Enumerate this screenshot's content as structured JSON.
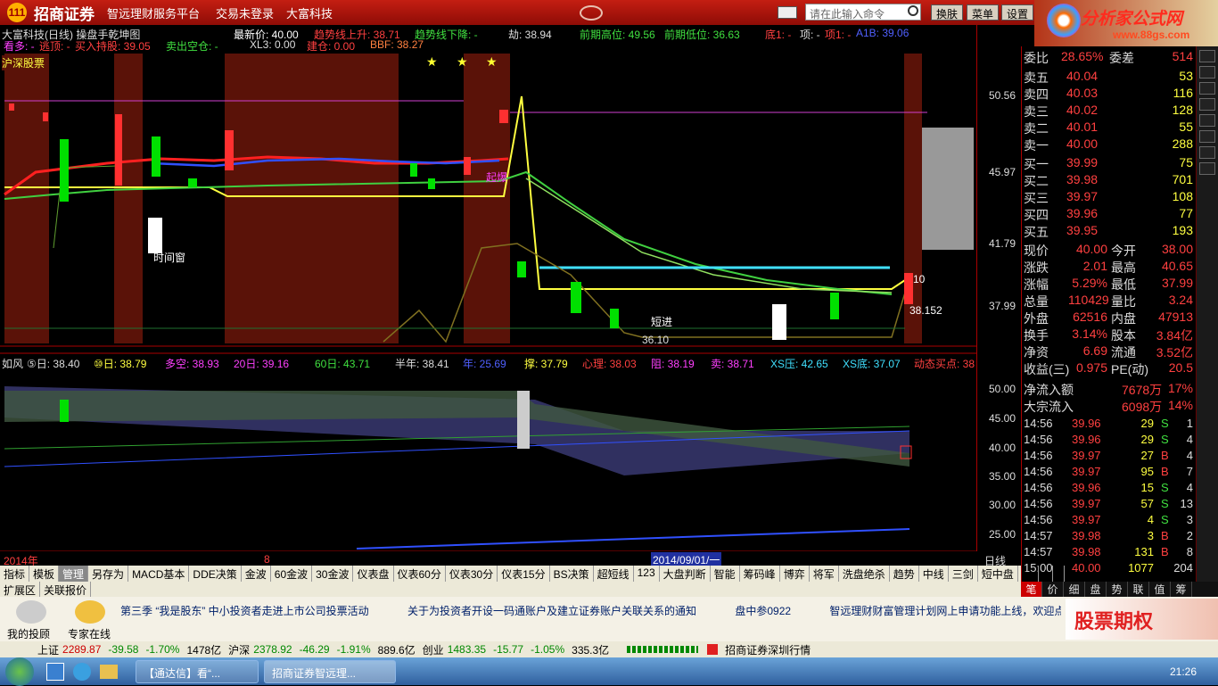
{
  "titlebar": {
    "logo": "111",
    "brand": "招商证券",
    "platform": "智远理财服务平台",
    "login": "交易未登录",
    "stock": "大富科技",
    "search_placeholder": "请在此输入命令",
    "btn_switch": "换肤",
    "btn_menu": "菜单",
    "btn_settings": "设置"
  },
  "ad": {
    "title": "分析家公式网",
    "url": "www.88gs.com"
  },
  "chart_header": {
    "name": "大富科技(日线) 操盘手乾坤图",
    "latest": "最新价: 40.00",
    "trend_up": "趋势线上升: 38.71",
    "trend_down": "趋势线下降: -",
    "jie": "劫: 38.94",
    "prev_high": "前期高位: 49.56",
    "prev_low": "前期低位: 36.63",
    "bottom": "底1: -",
    "top": "项: -",
    "top1": "项1: -",
    "a1b": "A1B: 39.06"
  },
  "chart_header2": {
    "kan": "看多: -",
    "escape": "逃顶: -",
    "buy": "买入持股: 39.05",
    "sell": "卖出空仓: -",
    "xl3": "XL3: 0.00",
    "jian": "建仓: 0.00",
    "bbf": "BBF: 38.27"
  },
  "labels": {
    "market": "沪深股票",
    "time_window": "时间窗",
    "qibao": "起爆",
    "short_enter": "短进",
    "low_val": "36.10",
    "val_right": "38.152",
    "val_10": "10"
  },
  "sub_header": {
    "name": "如风",
    "d5": "⑤日: 38.40",
    "d10": "⑩日: 38.79",
    "duokong": "多空: 38.93",
    "d20": "20日: 39.16",
    "d60": "60日: 43.71",
    "half": "半年: 38.41",
    "year": "年: 25.69",
    "cheng": "撑: 37.79",
    "psy": "心理: 38.03",
    "zu": "阻: 38.19",
    "mai": "卖: 38.71",
    "xsya": "XS压: 42.65",
    "xsdi": "XS底: 37.07",
    "dyn": "动态买点: 38"
  },
  "x_axis": {
    "year": "2014年",
    "month": "8",
    "cursor": "2014/09/01/一",
    "period": "日线"
  },
  "scale_top": [
    "50.56",
    "45.97",
    "41.79",
    "37.99"
  ],
  "scale_bottom": [
    "50.00",
    "45.00",
    "40.00",
    "35.00",
    "30.00",
    "25.00"
  ],
  "quote": {
    "weibi": {
      "l1": "委比",
      "v1": "28.65%",
      "l2": "委差",
      "v2": "514"
    },
    "sell": [
      {
        "l": "卖五",
        "p": "40.04",
        "v": "53"
      },
      {
        "l": "卖四",
        "p": "40.03",
        "v": "116"
      },
      {
        "l": "卖三",
        "p": "40.02",
        "v": "128"
      },
      {
        "l": "卖二",
        "p": "40.01",
        "v": "55"
      },
      {
        "l": "卖一",
        "p": "40.00",
        "v": "288"
      }
    ],
    "buy": [
      {
        "l": "买一",
        "p": "39.99",
        "v": "75"
      },
      {
        "l": "买二",
        "p": "39.98",
        "v": "701"
      },
      {
        "l": "买三",
        "p": "39.97",
        "v": "108"
      },
      {
        "l": "买四",
        "p": "39.96",
        "v": "77"
      },
      {
        "l": "买五",
        "p": "39.95",
        "v": "193"
      }
    ],
    "stats": [
      {
        "l1": "现价",
        "v1": "40.00",
        "l2": "今开",
        "v2": "38.00"
      },
      {
        "l1": "涨跌",
        "v1": "2.01",
        "l2": "最高",
        "v2": "40.65"
      },
      {
        "l1": "涨幅",
        "v1": "5.29%",
        "l2": "最低",
        "v2": "37.99"
      },
      {
        "l1": "总量",
        "v1": "110429",
        "l2": "量比",
        "v2": "3.24"
      },
      {
        "l1": "外盘",
        "v1": "62516",
        "l2": "内盘",
        "v2": "47913"
      },
      {
        "l1": "换手",
        "v1": "3.14%",
        "l2": "股本",
        "v2": "3.84亿"
      },
      {
        "l1": "净资",
        "v1": "6.69",
        "l2": "流通",
        "v2": "3.52亿"
      },
      {
        "l1": "收益(三)",
        "v1": "0.975",
        "l2": "PE(动)",
        "v2": "20.5"
      }
    ],
    "flow": [
      {
        "l": "净流入额",
        "v": "7678万",
        "p": "17%"
      },
      {
        "l": "大宗流入",
        "v": "6098万",
        "p": "14%"
      }
    ],
    "ticks": [
      {
        "t": "14:56",
        "p": "39.96",
        "v": "29",
        "s": "S",
        "n": "1"
      },
      {
        "t": "14:56",
        "p": "39.96",
        "v": "29",
        "s": "S",
        "n": "4"
      },
      {
        "t": "14:56",
        "p": "39.97",
        "v": "27",
        "s": "B",
        "n": "4"
      },
      {
        "t": "14:56",
        "p": "39.97",
        "v": "95",
        "s": "B",
        "n": "7"
      },
      {
        "t": "14:56",
        "p": "39.96",
        "v": "15",
        "s": "S",
        "n": "4"
      },
      {
        "t": "14:56",
        "p": "39.97",
        "v": "57",
        "s": "S",
        "n": "13"
      },
      {
        "t": "14:56",
        "p": "39.97",
        "v": "4",
        "s": "S",
        "n": "3"
      },
      {
        "t": "14:57",
        "p": "39.98",
        "v": "3",
        "s": "B",
        "n": "2"
      },
      {
        "t": "14:57",
        "p": "39.98",
        "v": "131",
        "s": "B",
        "n": "8"
      },
      {
        "t": "15:00",
        "p": "40.00",
        "v": "1077",
        "s": "",
        "n": "204"
      }
    ]
  },
  "tabs": [
    "指标",
    "模板",
    "管理",
    "另存为",
    "MACD基本",
    "DDE决策",
    "金波",
    "60金波",
    "30金波",
    "仪表盘",
    "仪表60分",
    "仪表30分",
    "仪表15分",
    "BS决策",
    "超短线",
    "123",
    "大盘判断",
    "智能",
    "筹码峰",
    "博弈",
    "将军",
    "洗盘绝杀",
    "趋势",
    "中线",
    "三剑",
    "短中盘",
    ">>",
    "+",
    "-"
  ],
  "tabs2": [
    "扩展区",
    "关联报价"
  ],
  "rtabs": [
    "笔",
    "价",
    "细",
    "盘",
    "势",
    "联",
    "值",
    "筹"
  ],
  "news": {
    "my_adviser": "我的投顾",
    "expert": "专家在线",
    "items": [
      "第三季 “我是股东” 中小投资者走进上市公司投票活动",
      "关于为投资者开设一码通账户及建立证券账户关联关系的通知",
      "盘中参0922",
      "智远理财财富管理计划网上申请功能上线，欢迎点击"
    ],
    "banner": "股票期权"
  },
  "status": {
    "sh": "上证",
    "sh_v": "2289.87",
    "sh_c": "-39.58",
    "sh_p": "-1.70%",
    "sh_a": "1478亿",
    "hs": "沪深",
    "hs_v": "2378.92",
    "hs_c": "-46.29",
    "hs_p": "-1.91%",
    "hs_a": "889.6亿",
    "cy": "创业",
    "cy_v": "1483.35",
    "cy_c": "-15.77",
    "cy_p": "-1.05%",
    "cy_a": "335.3亿",
    "market": "招商证券深圳行情"
  },
  "taskbar": {
    "t1": "【通达信】看“...",
    "t2": "招商证券智远理...",
    "time": "21:26"
  },
  "colors": {
    "up": "#ff3030",
    "down": "#00e000",
    "accent": "#c41e12"
  }
}
